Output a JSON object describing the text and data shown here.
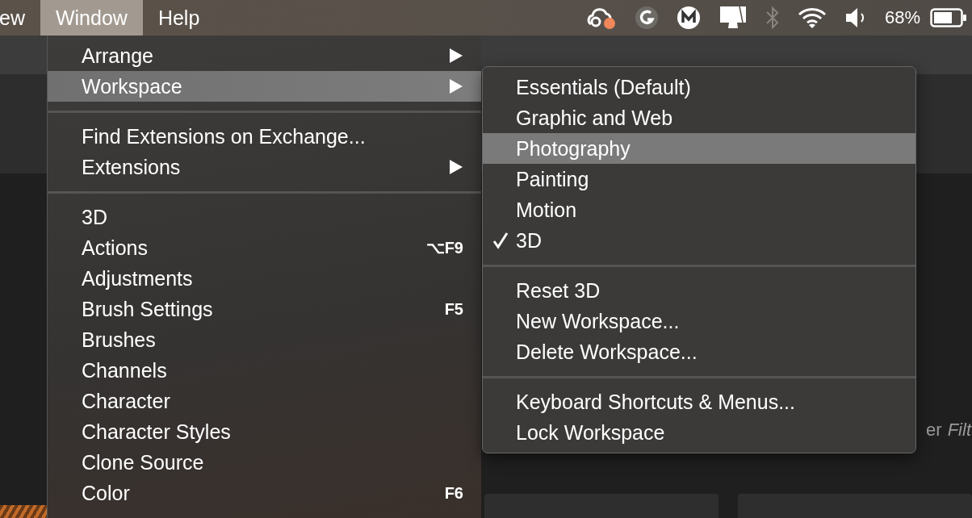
{
  "menu_bar": {
    "items": [
      {
        "label": "ew",
        "selected": false
      },
      {
        "label": "Window",
        "selected": true
      },
      {
        "label": "Help",
        "selected": false
      }
    ],
    "status": {
      "battery_text": "68%"
    }
  },
  "background": {
    "texts": [
      {
        "label": "er",
        "italic": false
      },
      {
        "label": "Filt",
        "italic": true
      }
    ]
  },
  "window_menu": {
    "items": [
      {
        "kind": "item",
        "label": "Arrange",
        "submenu": true,
        "selected": false
      },
      {
        "kind": "item",
        "label": "Workspace",
        "submenu": true,
        "selected": true
      },
      {
        "kind": "separator"
      },
      {
        "kind": "item",
        "label": "Find Extensions on Exchange...",
        "submenu": false,
        "selected": false
      },
      {
        "kind": "item",
        "label": "Extensions",
        "submenu": true,
        "selected": false
      },
      {
        "kind": "separator"
      },
      {
        "kind": "item",
        "label": "3D",
        "submenu": false,
        "selected": false
      },
      {
        "kind": "item",
        "label": "Actions",
        "submenu": false,
        "selected": false,
        "shortcut": "⌥F9"
      },
      {
        "kind": "item",
        "label": "Adjustments",
        "submenu": false,
        "selected": false
      },
      {
        "kind": "item",
        "label": "Brush Settings",
        "submenu": false,
        "selected": false,
        "shortcut": "F5"
      },
      {
        "kind": "item",
        "label": "Brushes",
        "submenu": false,
        "selected": false
      },
      {
        "kind": "item",
        "label": "Channels",
        "submenu": false,
        "selected": false
      },
      {
        "kind": "item",
        "label": "Character",
        "submenu": false,
        "selected": false
      },
      {
        "kind": "item",
        "label": "Character Styles",
        "submenu": false,
        "selected": false
      },
      {
        "kind": "item",
        "label": "Clone Source",
        "submenu": false,
        "selected": false
      },
      {
        "kind": "item",
        "label": "Color",
        "submenu": false,
        "selected": false,
        "shortcut": "F6"
      }
    ]
  },
  "workspace_submenu": {
    "items": [
      {
        "kind": "item",
        "label": "Essentials (Default)",
        "checked": false,
        "selected": false
      },
      {
        "kind": "item",
        "label": "Graphic and Web",
        "checked": false,
        "selected": false
      },
      {
        "kind": "item",
        "label": "Photography",
        "checked": false,
        "selected": true
      },
      {
        "kind": "item",
        "label": "Painting",
        "checked": false,
        "selected": false
      },
      {
        "kind": "item",
        "label": "Motion",
        "checked": false,
        "selected": false
      },
      {
        "kind": "item",
        "label": "3D",
        "checked": true,
        "selected": false
      },
      {
        "kind": "separator"
      },
      {
        "kind": "item",
        "label": "Reset 3D",
        "checked": false,
        "selected": false
      },
      {
        "kind": "item",
        "label": "New Workspace...",
        "checked": false,
        "selected": false
      },
      {
        "kind": "item",
        "label": "Delete Workspace...",
        "checked": false,
        "selected": false
      },
      {
        "kind": "separator"
      },
      {
        "kind": "item",
        "label": "Keyboard Shortcuts & Menus...",
        "checked": false,
        "selected": false
      },
      {
        "kind": "item",
        "label": "Lock Workspace",
        "checked": false,
        "selected": false
      }
    ]
  }
}
